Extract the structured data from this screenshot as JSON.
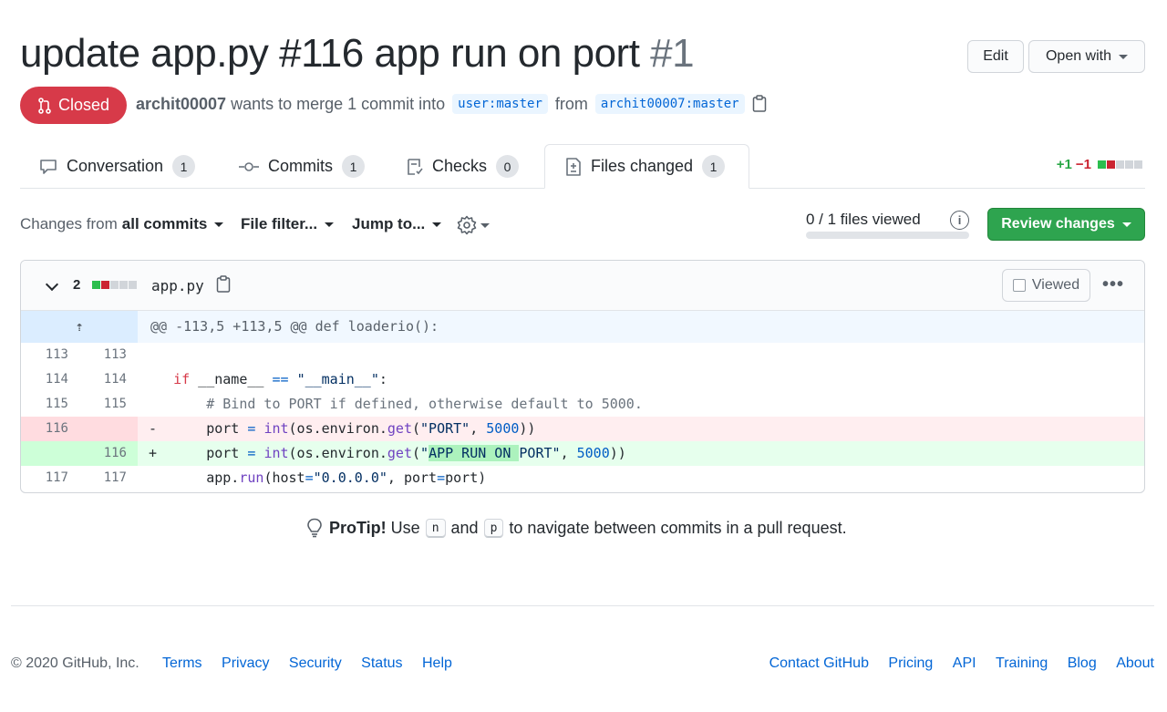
{
  "pr": {
    "title": "update app.py #116 app run on port",
    "number": "#1",
    "state": "Closed",
    "author": "archit00007",
    "merge_text": "wants to merge 1 commit into",
    "base_branch": "user:master",
    "from_text": "from",
    "head_branch": "archit00007:master"
  },
  "header_buttons": {
    "edit": "Edit",
    "open_with": "Open with"
  },
  "tabs": [
    {
      "label": "Conversation",
      "count": "1"
    },
    {
      "label": "Commits",
      "count": "1"
    },
    {
      "label": "Checks",
      "count": "0"
    },
    {
      "label": "Files changed",
      "count": "1"
    }
  ],
  "diffstat": {
    "additions": "+1",
    "deletions": "−1"
  },
  "toolbar": {
    "changes_from": "Changes from",
    "all_commits": "all commits",
    "file_filter": "File filter...",
    "jump_to": "Jump to...",
    "files_viewed": "0 / 1 files viewed",
    "review_changes": "Review changes"
  },
  "file": {
    "change_count": "2",
    "name": "app.py",
    "viewed_label": "Viewed",
    "hunk_header": "@@ -113,5 +113,5 @@ def loaderio():",
    "lines": [
      {
        "old": "113",
        "new": "113",
        "sign": " ",
        "text": ""
      },
      {
        "old": "114",
        "new": "114",
        "sign": " ",
        "text": "if __name__ == \"__main__\":"
      },
      {
        "old": "115",
        "new": "115",
        "sign": " ",
        "text": "    # Bind to PORT if defined, otherwise default to 5000."
      },
      {
        "old": "116",
        "new": "",
        "sign": "-",
        "text": "    port = int(os.environ.get(\"PORT\", 5000))"
      },
      {
        "old": "",
        "new": "116",
        "sign": "+",
        "text": "    port = int(os.environ.get(\"APP RUN ON PORT\", 5000))"
      },
      {
        "old": "117",
        "new": "117",
        "sign": " ",
        "text": "    app.run(host=\"0.0.0.0\", port=port)"
      }
    ]
  },
  "protip": {
    "label": "ProTip!",
    "use": "Use",
    "key1": "n",
    "and": "and",
    "key2": "p",
    "rest": "to navigate between commits in a pull request."
  },
  "footer": {
    "copyright": "© 2020 GitHub, Inc.",
    "left_links": [
      "Terms",
      "Privacy",
      "Security",
      "Status",
      "Help"
    ],
    "right_links": [
      "Contact GitHub",
      "Pricing",
      "API",
      "Training",
      "Blog",
      "About"
    ]
  },
  "colors": {
    "closed": "#d73a49",
    "add": "#2cbe4e",
    "del": "#cb2431",
    "link": "#0366d6",
    "review": "#2ea44f"
  },
  "icons": [
    "git-pull-request-icon",
    "clipboard-icon",
    "comment-icon",
    "commit-icon",
    "checklist-icon",
    "file-diff-icon",
    "gear-icon",
    "info-icon",
    "unfold-icon",
    "light-bulb-icon",
    "kebab-icon",
    "chevron-down-icon"
  ]
}
